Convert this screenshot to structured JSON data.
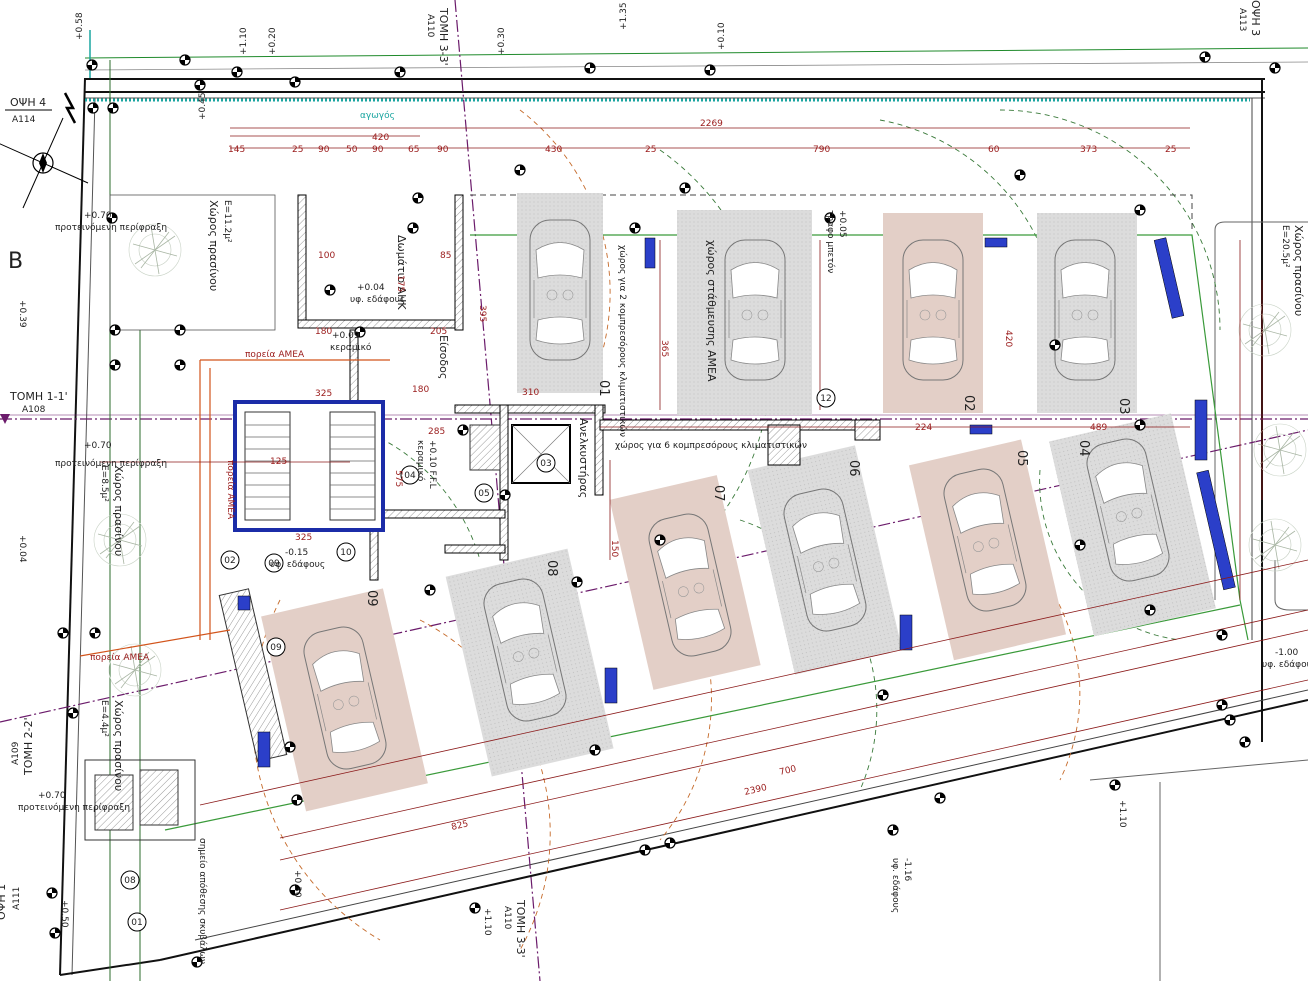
{
  "views": {
    "opsi4": "ΟΨΗ 4",
    "opsi4_ref": "A114",
    "opsi3": "ΟΨΗ 3",
    "opsi3_ref": "A113",
    "opsi1": "ΟΨΗ 1",
    "opsi1_ref": "A111",
    "tomi1": "ΤΟΜΗ 1-1'",
    "tomi1_ref": "A108",
    "tomi2": "ΤΟΜΗ 2-2'",
    "tomi2_ref": "A109",
    "tomi3_top": "ΤΟΜΗ 3-3'",
    "tomi3_top_ref": "A110",
    "tomi3_bot": "ΤΟΜΗ 3-3'",
    "tomi3_bot_ref": "A110",
    "north_letter": "N",
    "b_letter": "B"
  },
  "rooms": {
    "plant_1": "Χώρος πρασίνου",
    "plant_1_area": "E=11.2μ²",
    "plant_2": "Χώρος πρασίνου",
    "plant_2_area": "E=8.5μ²",
    "plant_3": "Χώρος πρασίνου",
    "plant_3_area": "E=4.4μ²",
    "plant_4": "Χώρος πρασίνου",
    "plant_4_area": "E=20.5μ²",
    "wc": "Δωμάτιο ΑΗΚ",
    "entrance": "Είσοδος",
    "lift": "Ανελκυστήρας",
    "compressors_6": "χώρος για 6 κομπρεσόρους κλιματιστικών",
    "compressors_2": "χώρος για 2 κομπρεσόρους κλιματιστικών",
    "disabled_parking": "χώρος στάθμευσης ΑΜΕΑ",
    "amea_path_1": "πορεία ΑΜΕΑ",
    "amea_path_2": "πορεία ΑΜΕΑ",
    "amea_path_3": "πορεία ΑΜΕΑ",
    "trash": "σημείο απόθεσης σκυβάλων",
    "duct": "αγωγός"
  },
  "parking_spots": [
    "01",
    "02",
    "03",
    "04",
    "05",
    "06",
    "07",
    "08",
    "09"
  ],
  "markers": [
    "01",
    "02",
    "03",
    "04",
    "05",
    "08",
    "09",
    "10",
    "12"
  ],
  "dimensions": {
    "d2269": "2269",
    "d420": "420",
    "d145": "145",
    "d25": "25",
    "d90": "90",
    "d50": "50",
    "d65": "65",
    "d430": "430",
    "d790": "790",
    "d60": "60",
    "d373": "373",
    "d395": "395",
    "d365": "365",
    "d420v": "420",
    "d310": "310",
    "d325": "325",
    "d180": "180",
    "d285": "285",
    "d224": "224",
    "d489": "489",
    "d205": "205",
    "d100": "100",
    "d175": "175",
    "d85": "85",
    "d125": "125",
    "d575": "575",
    "d150": "150",
    "d2390": "2390",
    "d700": "700",
    "d825": "825"
  },
  "levels": {
    "l_top1": "+0.58",
    "l_top2": "+1.10",
    "l_top3": "+0.20",
    "l_top4": "+0.30",
    "l_top5": "+0.45",
    "l_top6": "+1.35",
    "l_top7": "+0.10",
    "l_proposed_fence": "+0.70",
    "l_fence_label": "προτεινόμενη περίφραξη",
    "l_floor1": "+0.04",
    "l_floor1_label": "υφ. εδάφους",
    "l_floor2": "-0.15",
    "l_floor2_label": "υφ. εδάφους",
    "l_floor3": "+0.09",
    "l_floor3_label": "κεραμικό",
    "l_floor4": "+0.10 F.F.L",
    "l_floor4_label": "κεραμικό",
    "l_right": "-1.00",
    "l_right_label": "υφ. εδάφους",
    "l_bottom": "-1.16",
    "l_bottom_label": "υφ. εδάφους",
    "l_parking": "+0.05",
    "l_parking_label": "τραφο μπετόν",
    "l_left1": "+0.39",
    "l_left2": "+0.04",
    "l_left3": "+0.50",
    "l_south_a": "+1.10",
    "l_south_b": "+0.20",
    "l_south_c": "+0.30"
  }
}
